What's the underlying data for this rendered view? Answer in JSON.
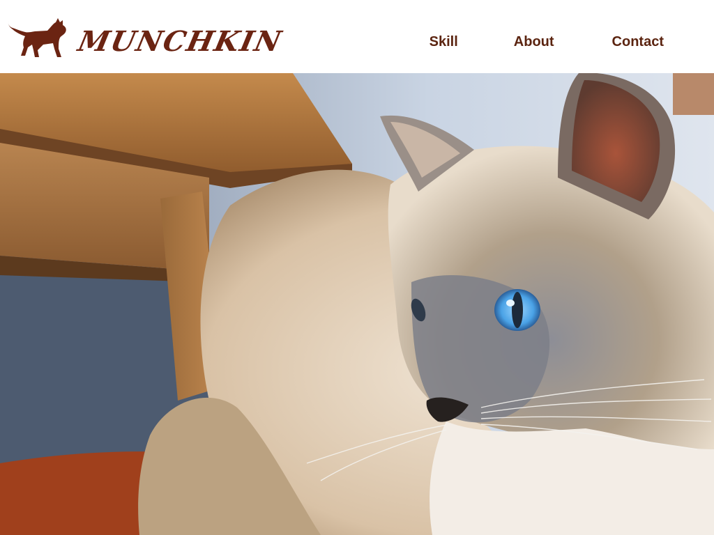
{
  "header": {
    "logo": {
      "text": "MUNCHKIN",
      "icon": "cat-silhouette-icon",
      "color": "#6b2412"
    },
    "nav": [
      {
        "label": "Skill"
      },
      {
        "label": "About"
      },
      {
        "label": "Contact"
      }
    ],
    "nav_color": "#5b2410"
  },
  "hero": {
    "image": "photo of a fluffy blue-eyed cat lying under a wooden table"
  },
  "colors": {
    "background": "#ffffff",
    "brand": "#6b2412"
  }
}
